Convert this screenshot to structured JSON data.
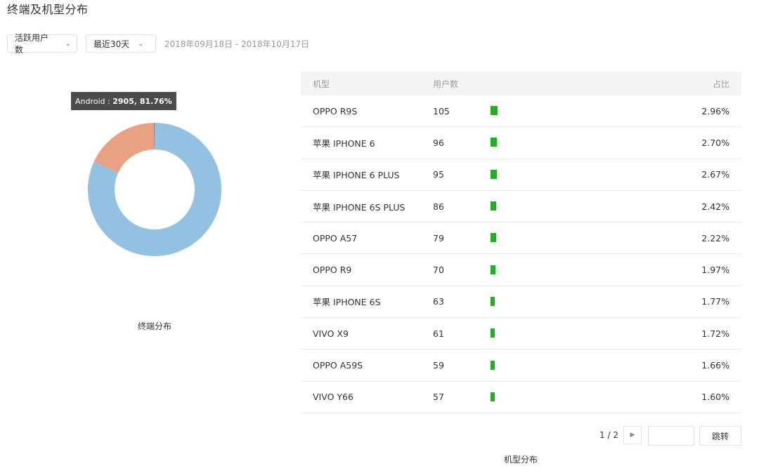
{
  "page": {
    "title": "终端及机型分布"
  },
  "filters": {
    "metric": "活跃用户数",
    "range": "最近30天",
    "date_range": "2018年09月18日 - 2018年10月17日"
  },
  "tooltip": {
    "label": "Android :",
    "value": "2905, 81.76%"
  },
  "colors": {
    "android": "#92c1e2",
    "ios": "#e9a183",
    "other": "#4caf50",
    "bar": "#1fb11f"
  },
  "chart_data": [
    {
      "type": "pie",
      "title": "终端分布",
      "slices": [
        {
          "name": "Android",
          "value": 2905,
          "percent": 81.76,
          "color": "#92c1e2"
        },
        {
          "name": "",
          "value": 640,
          "percent": 18.04,
          "color": "#e9a183"
        },
        {
          "name": "",
          "value": 7,
          "percent": 0.2,
          "color": "#4caf50"
        }
      ],
      "hole_ratio": 0.6
    },
    {
      "type": "table",
      "title": "机型分布",
      "columns": [
        "机型",
        "用户数",
        "",
        "占比"
      ],
      "rows": [
        {
          "model": "OPPO R9S",
          "users": "105",
          "share": "2.96%",
          "bar_value": 2.96
        },
        {
          "model": "苹果 IPHONE 6",
          "users": "96",
          "share": "2.70%",
          "bar_value": 2.7
        },
        {
          "model": "苹果 IPHONE 6 PLUS",
          "users": "95",
          "share": "2.67%",
          "bar_value": 2.67
        },
        {
          "model": "苹果 IPHONE 6S PLUS",
          "users": "86",
          "share": "2.42%",
          "bar_value": 2.42
        },
        {
          "model": "OPPO A57",
          "users": "79",
          "share": "2.22%",
          "bar_value": 2.22
        },
        {
          "model": "OPPO R9",
          "users": "70",
          "share": "1.97%",
          "bar_value": 1.97
        },
        {
          "model": "苹果 IPHONE 6S",
          "users": "63",
          "share": "1.77%",
          "bar_value": 1.77
        },
        {
          "model": "VIVO X9",
          "users": "61",
          "share": "1.72%",
          "bar_value": 1.72
        },
        {
          "model": "OPPO A59S",
          "users": "59",
          "share": "1.66%",
          "bar_value": 1.66
        },
        {
          "model": "VIVO Y66",
          "users": "57",
          "share": "1.60%",
          "bar_value": 1.6
        }
      ]
    }
  ],
  "pagination": {
    "page": "1 / 2",
    "jump_label": "跳转"
  }
}
